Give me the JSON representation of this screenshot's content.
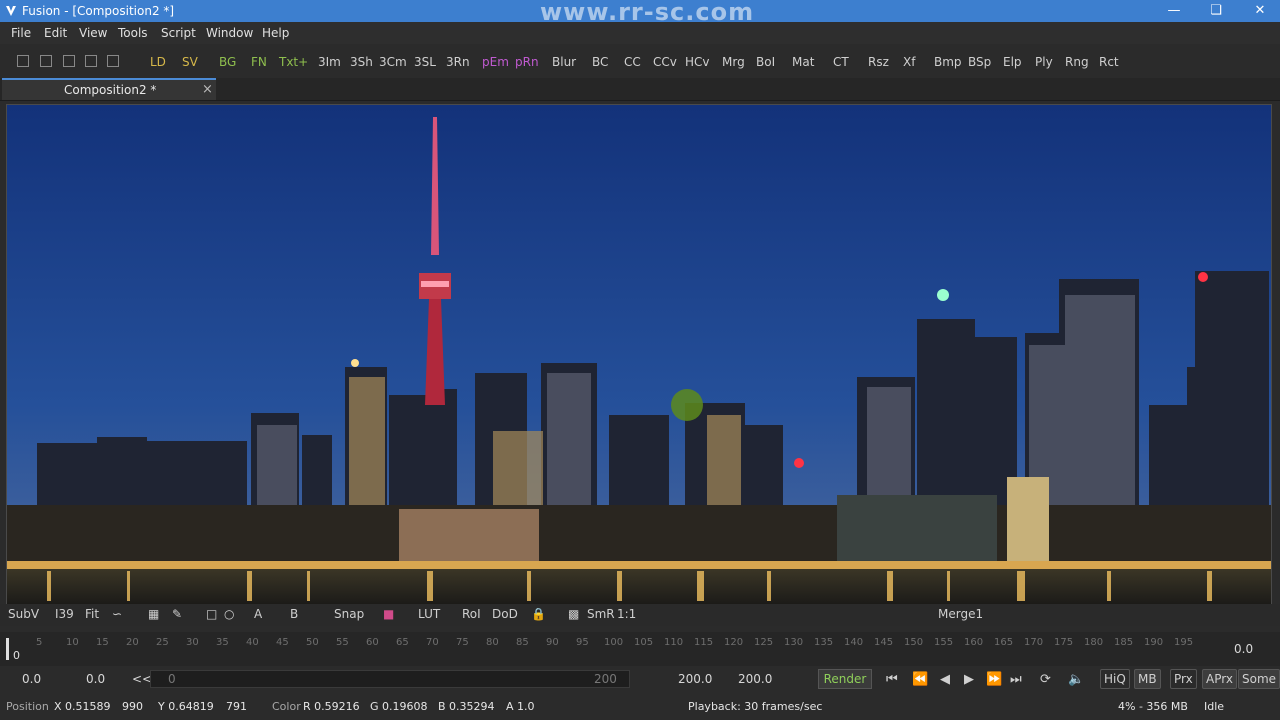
{
  "window": {
    "title": "Fusion - [Composition2 *]",
    "watermark": "www.rr-sc.com"
  },
  "menu": [
    "File",
    "Edit",
    "View",
    "Tools",
    "Script",
    "Window",
    "Help"
  ],
  "toolbar": [
    "LD",
    "SV",
    "BG",
    "FN",
    "Txt+",
    "3Im",
    "3Sh",
    "3Cm",
    "3SL",
    "3Rn",
    "pEm",
    "pRn",
    "Blur",
    "BC",
    "CC",
    "CCv",
    "HCv",
    "Mrg",
    "BoI",
    "Mat",
    "CT",
    "Rsz",
    "Xf",
    "Bmp",
    "BSp",
    "Elp",
    "Ply",
    "Rng",
    "Rct"
  ],
  "tab": {
    "label": "Composition2 *",
    "close": "×"
  },
  "viewer_bar": {
    "subv": "SubV",
    "zoom": "I39",
    "fit": "Fit",
    "letters": [
      "A",
      "B"
    ],
    "snap": "Snap",
    "lut": "LUT",
    "roi": "RoI",
    "dod": "DoD",
    "smr": "SmR",
    "ratio": "1:1",
    "node": "Merge1"
  },
  "timeline": {
    "ticks": [
      "5",
      "10",
      "15",
      "20",
      "25",
      "30",
      "35",
      "40",
      "45",
      "50",
      "55",
      "60",
      "65",
      "70",
      "75",
      "80",
      "85",
      "90",
      "95",
      "100",
      "105",
      "110",
      "115",
      "120",
      "125",
      "130",
      "135",
      "140",
      "145",
      "150",
      "155",
      "160",
      "165",
      "170",
      "175",
      "180",
      "185",
      "190",
      "195"
    ],
    "current": "0",
    "end_value": "0.0"
  },
  "transport": {
    "start": "0.0",
    "current": "0.0",
    "rewind": "<<",
    "range_start": "0",
    "range_end": "200",
    "end": "200.0",
    "global_end": "200.0",
    "render": "Render",
    "hiq": "HiQ",
    "mb": "MB",
    "prx": "Prx",
    "aprx": "APrx",
    "some": "Some"
  },
  "status": {
    "position_label": "Position",
    "x": "X 0.51589",
    "px": "990",
    "y": "Y 0.64819",
    "py": "791",
    "color_label": "Color",
    "r": "R 0.59216",
    "g": "G 0.19608",
    "b": "B 0.35294",
    "a": "A 1.0",
    "playback": "Playback: 30 frames/sec",
    "memory": "4% - 356 MB",
    "state": "Idle"
  },
  "colors": {
    "titlebar": "#3d7fcf",
    "accent_green": "#8fbf4e",
    "accent_purple": "#c05ad0"
  },
  "viewer_image": "night city skyline with illuminated tower reflected in water"
}
